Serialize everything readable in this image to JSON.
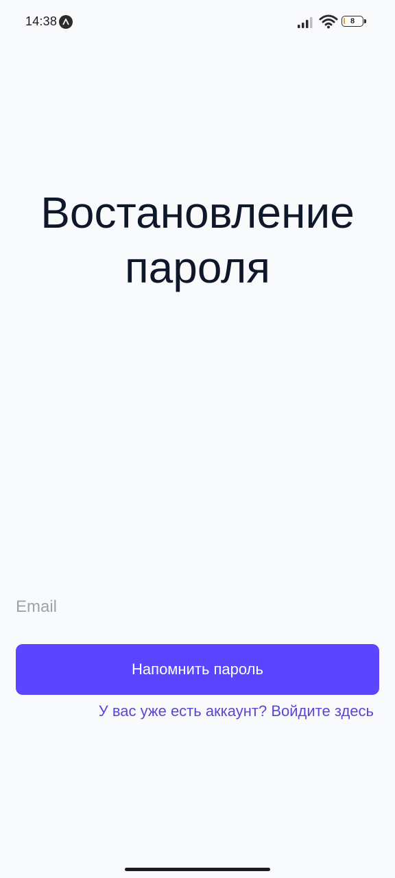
{
  "status_bar": {
    "time": "14:38",
    "battery_level": "8",
    "battery_fraction": 0.08,
    "icons": [
      "app-badge-icon",
      "signal-icon",
      "wifi-icon",
      "battery-icon"
    ]
  },
  "page": {
    "title_line1": "Востановление",
    "title_line2": "пароля"
  },
  "form": {
    "email_placeholder": "Email",
    "email_value": "",
    "submit_label": "Напомнить пароль",
    "login_link": "У вас уже есть аккаунт? Войдите здесь"
  },
  "colors": {
    "background": "#f9fafc",
    "accent": "#5b45ff",
    "link": "#5b45d6",
    "title": "#0f172a",
    "placeholder": "#9ca3af"
  }
}
